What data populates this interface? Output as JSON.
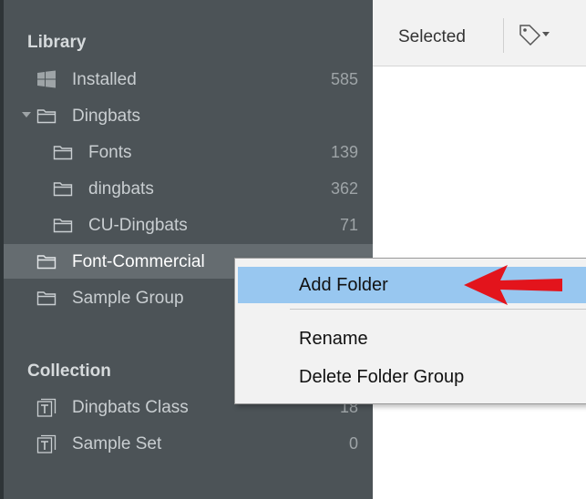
{
  "sidebar": {
    "library_title": "Library",
    "collection_title": "Collection",
    "library_items": [
      {
        "label": "Installed",
        "count": "585",
        "icon": "windows-icon"
      },
      {
        "label": "Dingbats",
        "count": "",
        "icon": "folder-icon"
      },
      {
        "label": "Fonts",
        "count": "139",
        "icon": "folder-icon"
      },
      {
        "label": "dingbats",
        "count": "362",
        "icon": "folder-icon"
      },
      {
        "label": "CU-Dingbats",
        "count": "71",
        "icon": "folder-icon"
      },
      {
        "label": "Font-Commercial",
        "count": "",
        "icon": "folder-icon"
      },
      {
        "label": "Sample Group",
        "count": "",
        "icon": "folder-icon"
      }
    ],
    "collection_items": [
      {
        "label": "Dingbats Class",
        "count": "18",
        "icon": "font-collection-icon"
      },
      {
        "label": "Sample Set",
        "count": "0",
        "icon": "font-collection-icon"
      }
    ]
  },
  "toolbar": {
    "selected_label": "Selected",
    "tag_icon": "tag-icon"
  },
  "context_menu": {
    "items": [
      "Add Folder",
      "Rename",
      "Delete Folder Group"
    ],
    "hovered_item": "Add Folder",
    "highlight_color": "#98c7f0"
  },
  "annotation": {
    "arrow_color": "#e3141c"
  }
}
